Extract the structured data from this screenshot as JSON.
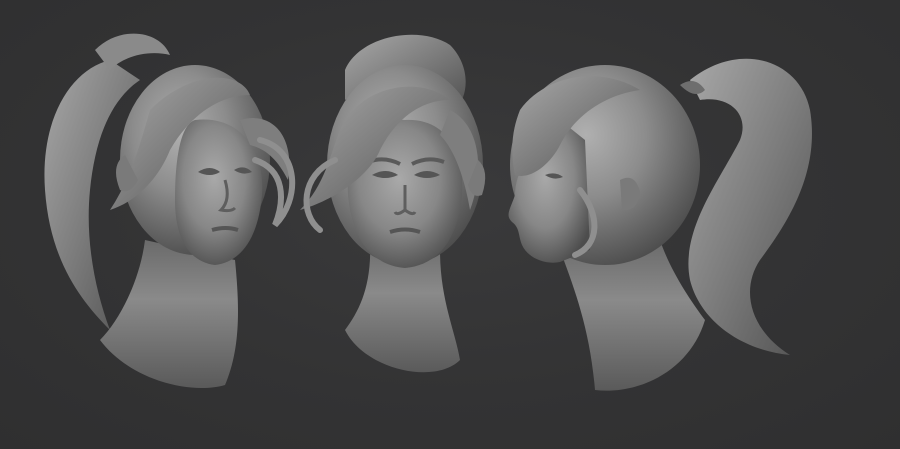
{
  "scene": {
    "background_color": "#333334",
    "clay_color": "#8e8e8e",
    "views": [
      {
        "name": "three-quarter-view",
        "icon": "sculpt-head-three-quarter"
      },
      {
        "name": "front-view",
        "icon": "sculpt-head-front"
      },
      {
        "name": "side-profile-view",
        "icon": "sculpt-head-profile"
      }
    ]
  }
}
